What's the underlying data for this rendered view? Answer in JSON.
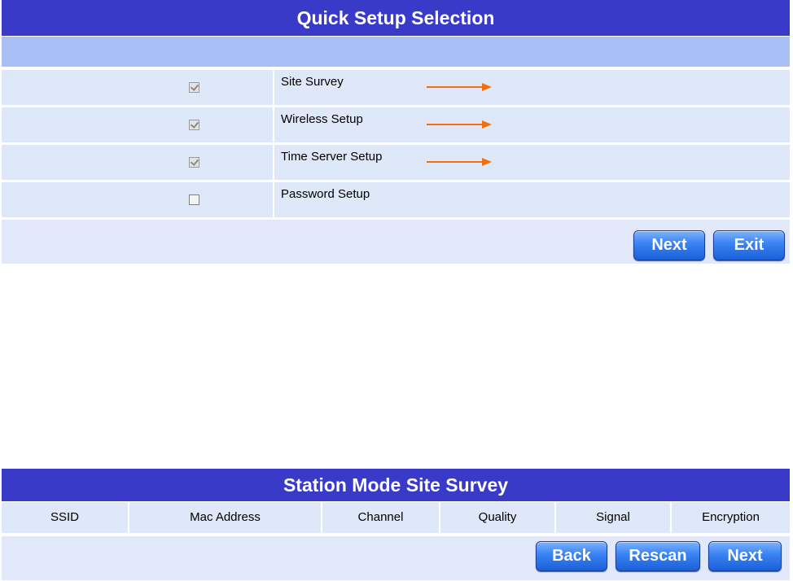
{
  "quick_setup": {
    "title": "Quick Setup Selection",
    "options": [
      {
        "label": "Site Survey",
        "checked": true,
        "arrow": true
      },
      {
        "label": "Wireless Setup",
        "checked": true,
        "arrow": true
      },
      {
        "label": "Time Server Setup",
        "checked": true,
        "arrow": true
      },
      {
        "label": "Password Setup",
        "checked": false,
        "arrow": false
      }
    ],
    "buttons": {
      "next": "Next",
      "exit": "Exit"
    }
  },
  "site_survey": {
    "title": "Station Mode Site Survey",
    "columns": [
      "SSID",
      "Mac Address",
      "Channel",
      "Quality",
      "Signal",
      "Encryption"
    ],
    "buttons": {
      "back": "Back",
      "rescan": "Rescan",
      "next": "Next"
    }
  },
  "colors": {
    "title_bar": "#3a3ac8",
    "subheader": "#a9c0f7",
    "row_bg": "#dfe8f8",
    "arrow": "#f07010",
    "button": "#3d86f5"
  },
  "icons": {
    "checkbox": "checkbox-icon",
    "arrow": "right-arrow-icon"
  }
}
